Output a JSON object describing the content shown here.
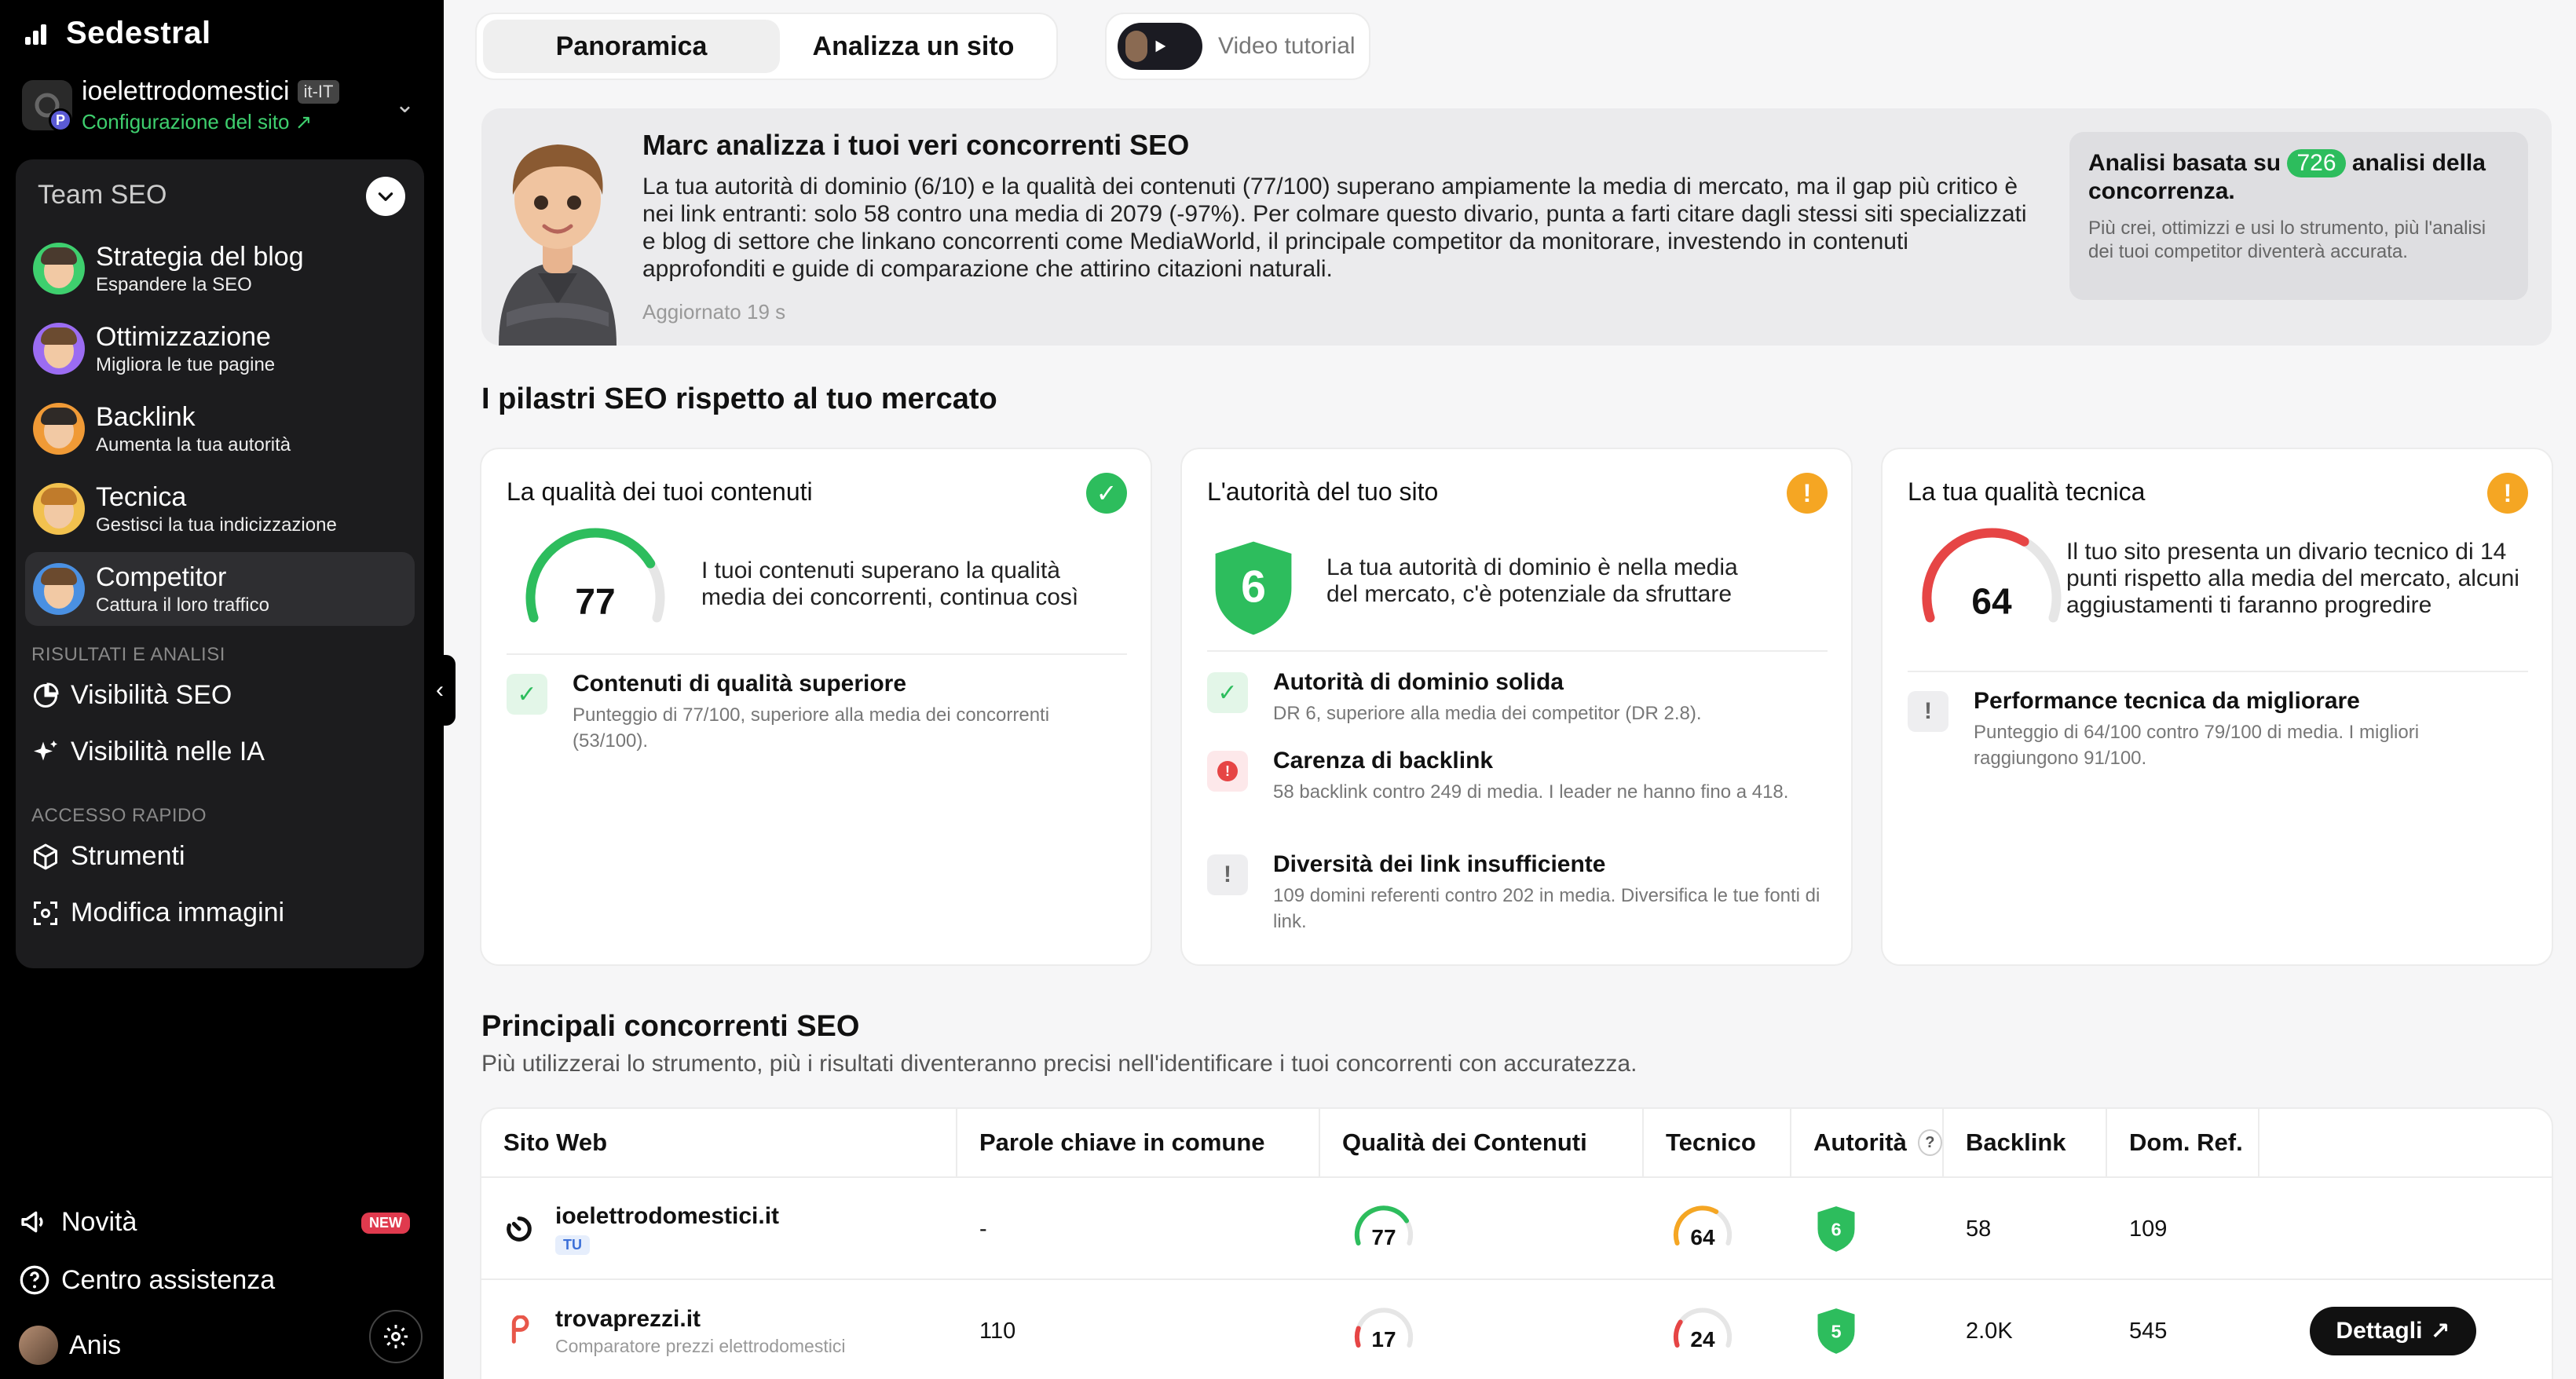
{
  "sidebar": {
    "brand": "Sedestral",
    "site": {
      "name": "ioelettrodomestici",
      "locale": "it-IT",
      "config_link": "Configurazione del sito ↗",
      "avatar_badge": "P"
    },
    "team_label": "Team SEO",
    "agents": [
      {
        "title": "Strategia del blog",
        "subtitle": "Espandere la SEO",
        "hair": "#4a3a2e",
        "ring": "#3ecf6e"
      },
      {
        "title": "Ottimizzazione",
        "subtitle": "Migliora le tue pagine",
        "hair": "#6b4b30",
        "ring": "#9b6cf2"
      },
      {
        "title": "Backlink",
        "subtitle": "Aumenta la tua autorità",
        "hair": "#2f2a27",
        "ring": "#f09a36"
      },
      {
        "title": "Tecnica",
        "subtitle": "Gestisci la tua indicizzazione",
        "hair": "#c07b2b",
        "ring": "#f2c14e"
      },
      {
        "title": "Competitor",
        "subtitle": "Cattura il loro traffico",
        "hair": "#6b4a2e",
        "ring": "#4a90e2"
      }
    ],
    "results_label": "RISULTATI E ANALISI",
    "results_items": [
      "Visibilità SEO",
      "Visibilità nelle IA"
    ],
    "quick_label": "ACCESSO RAPIDO",
    "quick_items": [
      "Strumenti",
      "Modifica immagini"
    ],
    "bottom": {
      "news": "Novità",
      "news_badge": "NEW",
      "help": "Centro assistenza",
      "user": "Anis"
    }
  },
  "tabs": [
    {
      "label": "Panoramica",
      "active": true
    },
    {
      "label": "Analizza un sito",
      "active": false
    }
  ],
  "video_tutorial": "Video tutorial",
  "hero": {
    "title": "Marc analizza i tuoi veri concorrenti SEO",
    "text": "La tua autorità di dominio (6/10) e la qualità dei contenuti (77/100) superano ampiamente la media di mercato, ma il gap più critico è nei link entranti: solo 58 contro una media di 2079 (-97%). Per colmare questo divario, punta a farti citare dagli stessi siti specializzati e blog di settore che linkano concorrenti come MediaWorld, il principale competitor da monitorare, investendo in contenuti approfonditi e guide di comparazione che attirino citazioni naturali.",
    "updated": "Aggiornato 19 s",
    "box_title_prefix": "Analisi basata su",
    "box_count": "726",
    "box_title_suffix": "analisi della concorrenza.",
    "box_sub": "Più crei, ottimizzi e usi lo strumento, più l'analisi dei tuoi competitor diventerà accurata."
  },
  "pillars_title": "I pilastri SEO rispetto al tuo mercato",
  "cards": [
    {
      "title": "La qualità dei tuoi contenuti",
      "status": "ok",
      "score": "77",
      "desc": "I tuoi contenuti superano la qualità media dei concorrenti, continua così",
      "issues": [
        {
          "type": "ok",
          "title": "Contenuti di qualità superiore",
          "text": "Punteggio di 77/100, superiore alla media dei concorrenti (53/100)."
        }
      ]
    },
    {
      "title": "L'autorità del tuo sito",
      "status": "warn",
      "score": "6",
      "desc": "La tua autorità di dominio è nella media del mercato, c'è potenziale da sfruttare",
      "issues": [
        {
          "type": "ok",
          "title": "Autorità di dominio solida",
          "text": "DR 6, superiore alla media dei competitor (DR 2.8)."
        },
        {
          "type": "error",
          "title": "Carenza di backlink",
          "text": "58 backlink contro 249 di media. I leader ne hanno fino a 418."
        },
        {
          "type": "info",
          "title": "Diversità dei link insufficiente",
          "text": "109 domini referenti contro 202 in media. Diversifica le tue fonti di link."
        }
      ]
    },
    {
      "title": "La tua qualità tecnica",
      "status": "warn",
      "score": "64",
      "desc": "Il tuo sito presenta un divario tecnico di 14 punti rispetto alla media del mercato, alcuni aggiustamenti ti faranno progredire",
      "issues": [
        {
          "type": "info",
          "title": "Performance tecnica da migliorare",
          "text": "Punteggio di 64/100 contro 79/100 di media. I migliori raggiungono 91/100."
        }
      ]
    }
  ],
  "competitors": {
    "title": "Principali concorrenti SEO",
    "subtitle": "Più utilizzerai lo strumento, più i risultati diventeranno precisi nell'identificare i tuoi concorrenti con accuratezza.",
    "headers": [
      "Sito Web",
      "Parole chiave in comune",
      "Qualità dei Contenuti",
      "Tecnico",
      "Autorità",
      "Backlink",
      "Dom. Ref."
    ],
    "help_mark": "?",
    "rows": [
      {
        "site": "ioelettrodomestici.it",
        "badge": "TU",
        "desc": "",
        "keywords": "-",
        "quality": "77",
        "technical": "64",
        "authority": "6",
        "backlinks": "58",
        "refdomains": "109",
        "details": ""
      },
      {
        "site": "trovaprezzi.it",
        "badge": "",
        "desc": "Comparatore prezzi elettrodomestici",
        "keywords": "110",
        "quality": "17",
        "technical": "24",
        "authority": "5",
        "backlinks": "2.0K",
        "refdomains": "545",
        "details": "Dettagli"
      }
    ]
  },
  "colors": {
    "green": "#2dbd5d",
    "orange": "#f5a623",
    "red": "#e64545",
    "sidebar_bg": "#000000"
  },
  "icons": {
    "status_ok": "✓",
    "status_warn": "!",
    "status_error": "!",
    "status_info": "!",
    "chevron_down": "⌄",
    "collapse": "‹",
    "external_link": "↗"
  }
}
